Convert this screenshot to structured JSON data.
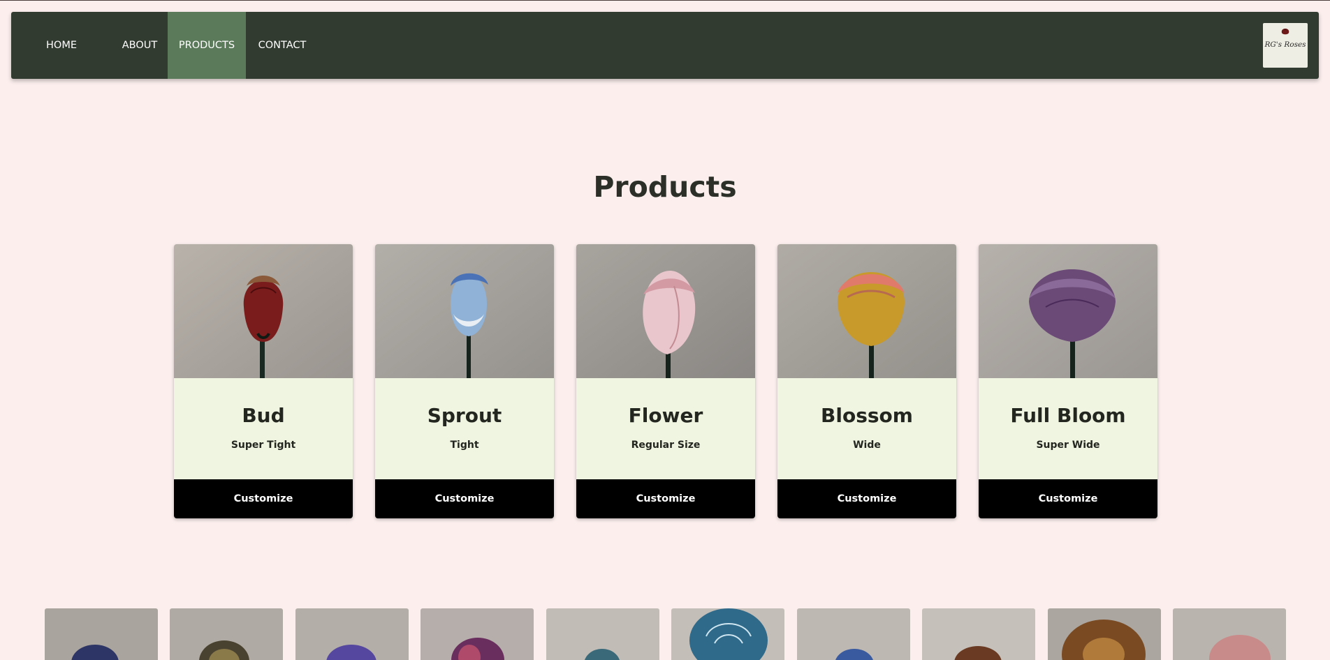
{
  "nav": {
    "items": [
      {
        "label": "HOME",
        "active": false
      },
      {
        "label": "ABOUT",
        "active": false
      },
      {
        "label": "PRODUCTS",
        "active": true
      },
      {
        "label": "CONTACT",
        "active": false
      }
    ],
    "logo_text": "RG's Roses",
    "colors": {
      "bar": "#313b30",
      "active": "#5a7a59"
    }
  },
  "page": {
    "title": "Products",
    "background": "#fbeeed"
  },
  "products": [
    {
      "name": "Bud",
      "subtitle": "Super Tight",
      "button": "Customize",
      "rose_color": "#7a1c1c"
    },
    {
      "name": "Sprout",
      "subtitle": "Tight",
      "button": "Customize",
      "rose_color": "#5d86c4"
    },
    {
      "name": "Flower",
      "subtitle": "Regular Size",
      "button": "Customize",
      "rose_color": "#e6c3c7"
    },
    {
      "name": "Blossom",
      "subtitle": "Wide",
      "button": "Customize",
      "rose_color": "#d4a032"
    },
    {
      "name": "Full Bloom",
      "subtitle": "Super Wide",
      "button": "Customize",
      "rose_color": "#6b4a78"
    }
  ],
  "gallery": [
    {
      "icon": "navy-rose-image",
      "color": "#2d3566"
    },
    {
      "icon": "gold-rose-image",
      "color": "#7a6a3a"
    },
    {
      "icon": "violet-rose-image",
      "color": "#5546a0"
    },
    {
      "icon": "magenta-rose-image",
      "color": "#7a3a6a"
    },
    {
      "icon": "teal-rose-image",
      "color": "#3a6a7a"
    },
    {
      "icon": "blue-rose-image",
      "color": "#3f7fa0"
    },
    {
      "icon": "cobalt-rose-image",
      "color": "#3a5aa0"
    },
    {
      "icon": "copper-rose-image",
      "color": "#7a4a2a"
    },
    {
      "icon": "bronze-rose-image",
      "color": "#9a5a2a"
    },
    {
      "icon": "pink-rose-image",
      "color": "#c98a8a"
    }
  ]
}
